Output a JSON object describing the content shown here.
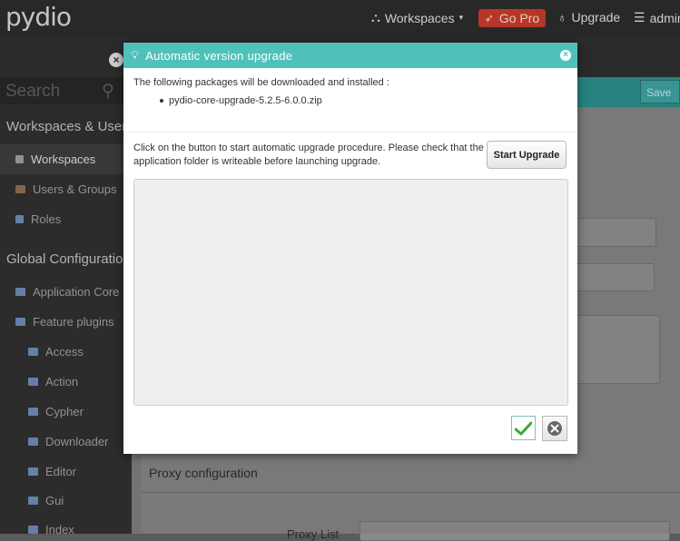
{
  "header": {
    "logo": "pydio",
    "workspaces_label": "Workspaces",
    "gopro_label": "Go Pro",
    "upgrade_label": "Upgrade",
    "user_label": "admin"
  },
  "sidebar": {
    "search_placeholder": "Search",
    "section1_title": "Workspaces & Users",
    "items1": [
      {
        "label": "Workspaces"
      },
      {
        "label": "Users & Groups"
      },
      {
        "label": "Roles"
      }
    ],
    "section2_title": "Global Configuration",
    "items2": [
      {
        "label": "Application Core"
      },
      {
        "label": "Feature plugins"
      },
      {
        "label": "Access"
      },
      {
        "label": "Action"
      },
      {
        "label": "Cypher"
      },
      {
        "label": "Downloader"
      },
      {
        "label": "Editor"
      },
      {
        "label": "Gui"
      },
      {
        "label": "Index"
      }
    ]
  },
  "main": {
    "save_label": "Save",
    "proxy_title": "Proxy configuration",
    "proxy_list_label": "Proxy List"
  },
  "dialog": {
    "title": "Automatic version upgrade",
    "intro": "The following packages will be downloaded and installed :",
    "package": "pydio-core-upgrade-5.2.5-6.0.0.zip",
    "instructions": "Click on the button to start automatic upgrade procedure. Please check that the application folder is writeable before launching upgrade.",
    "start_button": "Start Upgrade",
    "colors": {
      "header": "#4fc1bb",
      "ok": "#3aa93a",
      "cancel": "#666666"
    }
  }
}
